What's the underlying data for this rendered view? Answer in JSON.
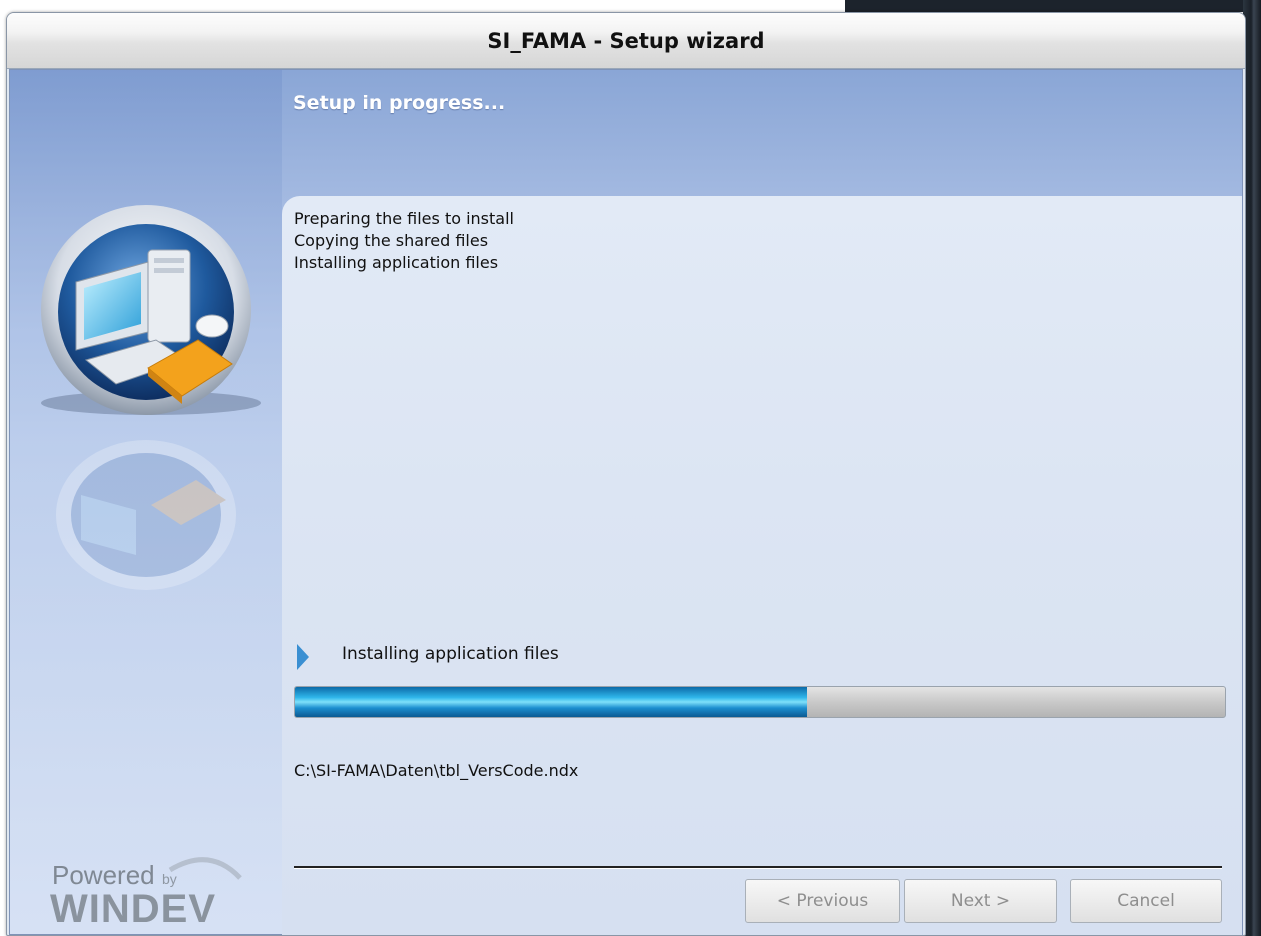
{
  "window": {
    "title": "SI_FAMA - Setup wizard"
  },
  "header": {
    "heading": "Setup in progress..."
  },
  "log": {
    "items": [
      "Preparing the files to install",
      "Copying the shared files",
      "Installing application files"
    ]
  },
  "current_step": {
    "label": "Installing application files"
  },
  "progress": {
    "value_percent": 55
  },
  "current_file": {
    "path": "C:\\SI-FAMA\\Daten\\tbl_VersCode.ndx"
  },
  "buttons": {
    "previous": "< Previous",
    "next": "Next >",
    "cancel": "Cancel"
  },
  "branding": {
    "powered": "Powered",
    "by": "by",
    "product": "WINDEV"
  },
  "colors": {
    "progress_accent": "#2fb6ea",
    "heading_text": "#ffffff",
    "step_arrow": "#3a8fd2"
  }
}
